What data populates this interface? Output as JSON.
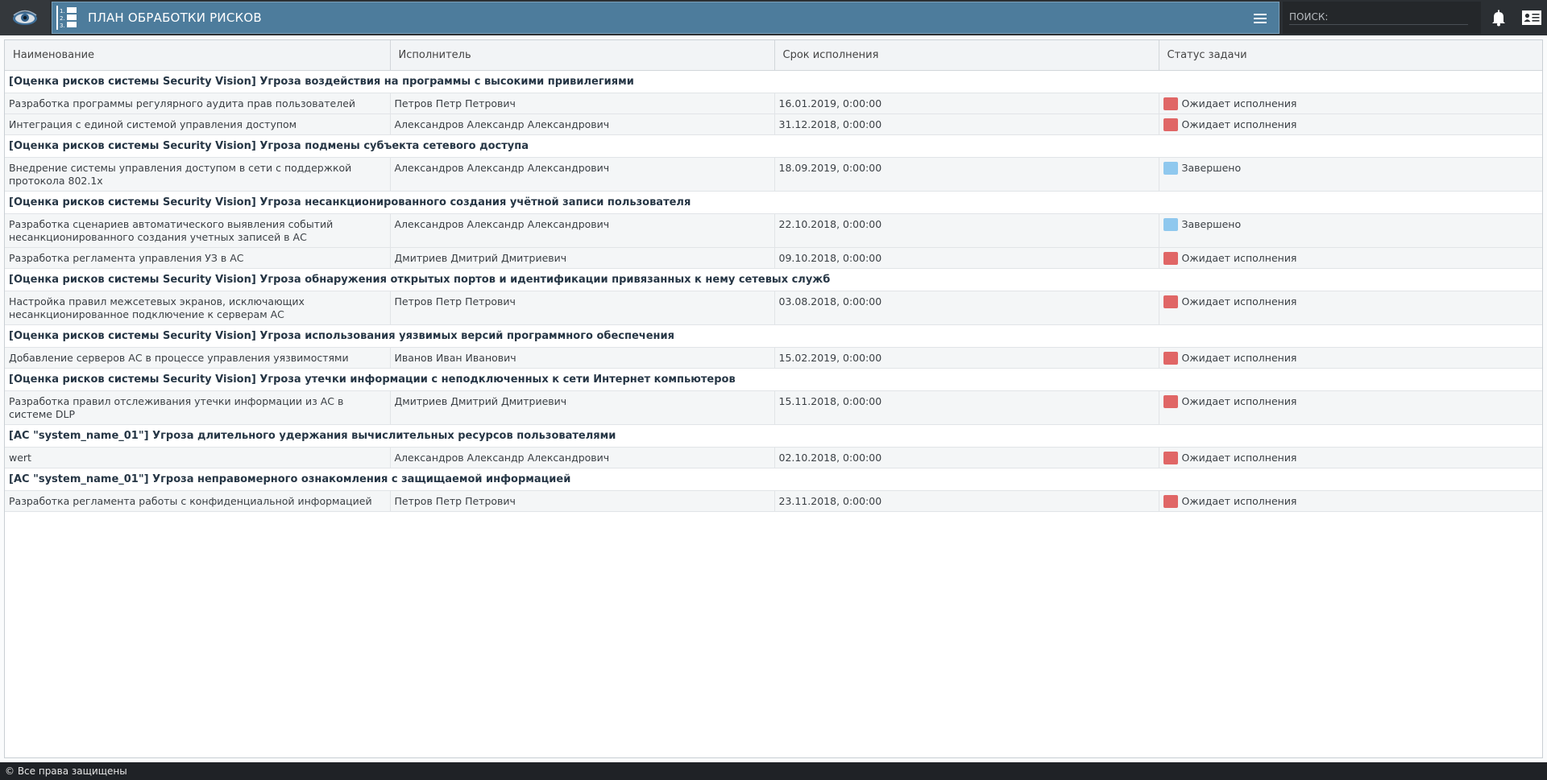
{
  "app": {
    "title": "ПЛАН ОБРАБОТКИ РИСКОВ",
    "search_label": "ПОИСК:",
    "footer": "© Все права защищены"
  },
  "colors": {
    "header_blue": "#4d7c9c",
    "status_pending": "#e06666",
    "status_done": "#8fc8ee"
  },
  "table": {
    "columns": [
      "Наименование",
      "Исполнитель",
      "Срок исполнения",
      "Статус задачи"
    ],
    "groups": [
      {
        "title": "[Оценка рисков системы Security Vision] Угроза воздействия на программы с высокими привилегиями",
        "rows": [
          {
            "name": "Разработка программы регулярного аудита прав пользователей",
            "assignee": "Петров Петр Петрович",
            "due": "16.01.2019, 0:00:00",
            "status": "Ожидает исполнения",
            "status_color": "#e06666"
          },
          {
            "name": "Интеграция с единой системой управления доступом",
            "assignee": "Александров Александр Александрович",
            "due": "31.12.2018, 0:00:00",
            "status": "Ожидает исполнения",
            "status_color": "#e06666"
          }
        ]
      },
      {
        "title": "[Оценка рисков системы Security Vision] Угроза подмены субъекта сетевого доступа",
        "rows": [
          {
            "name": "Внедрение системы управления доступом в сети с поддержкой протокола 802.1x",
            "assignee": "Александров Александр Александрович",
            "due": "18.09.2019, 0:00:00",
            "status": "Завершено",
            "status_color": "#8fc8ee"
          }
        ]
      },
      {
        "title": "[Оценка рисков системы Security Vision] Угроза несанкционированного создания учётной записи пользователя",
        "rows": [
          {
            "name": "Разработка сценариев автоматического выявления событий несанкционированного создания учетных записей в АС",
            "assignee": "Александров Александр Александрович",
            "due": "22.10.2018, 0:00:00",
            "status": "Завершено",
            "status_color": "#8fc8ee"
          },
          {
            "name": "Разработка регламента управления УЗ в АС",
            "assignee": "Дмитриев Дмитрий Дмитриевич",
            "due": "09.10.2018, 0:00:00",
            "status": "Ожидает исполнения",
            "status_color": "#e06666"
          }
        ]
      },
      {
        "title": "[Оценка рисков системы Security Vision] Угроза обнаружения открытых портов и идентификации привязанных к нему сетевых служб",
        "rows": [
          {
            "name": "Настройка правил межсетевых экранов, исключающих несанкционированное подключение к серверам АС",
            "assignee": "Петров Петр Петрович",
            "due": "03.08.2018, 0:00:00",
            "status": "Ожидает исполнения",
            "status_color": "#e06666"
          }
        ]
      },
      {
        "title": "[Оценка рисков системы Security Vision] Угроза использования уязвимых версий программного обеспечения",
        "rows": [
          {
            "name": "Добавление серверов АС в процессе управления уязвимостями",
            "assignee": "Иванов Иван Иванович",
            "due": "15.02.2019, 0:00:00",
            "status": "Ожидает исполнения",
            "status_color": "#e06666"
          }
        ]
      },
      {
        "title": "[Оценка рисков системы Security Vision] Угроза утечки информации с неподключенных к сети Интернет компьютеров",
        "rows": [
          {
            "name": "Разработка правил отслеживания утечки информации из АС в системе DLP",
            "assignee": "Дмитриев Дмитрий Дмитриевич",
            "due": "15.11.2018, 0:00:00",
            "status": "Ожидает исполнения",
            "status_color": "#e06666"
          }
        ]
      },
      {
        "title": "[АС \"system_name_01\"] Угроза длительного удержания вычислительных ресурсов пользователями",
        "rows": [
          {
            "name": "wert",
            "assignee": "Александров Александр Александрович",
            "due": "02.10.2018, 0:00:00",
            "status": "Ожидает исполнения",
            "status_color": "#e06666"
          }
        ]
      },
      {
        "title": "[АС \"system_name_01\"] Угроза неправомерного ознакомления с защищаемой информацией",
        "rows": [
          {
            "name": "Разработка регламента работы с конфиденциальной информацией",
            "assignee": "Петров Петр Петрович",
            "due": "23.11.2018, 0:00:00",
            "status": "Ожидает исполнения",
            "status_color": "#e06666"
          }
        ]
      }
    ]
  }
}
